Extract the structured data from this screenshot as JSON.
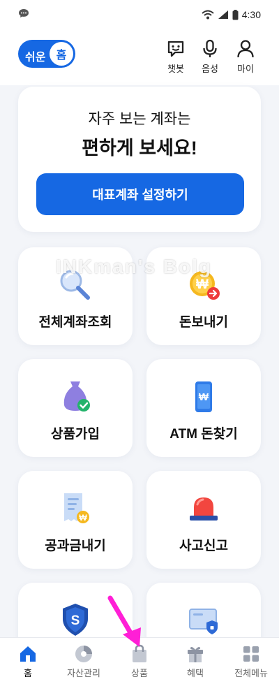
{
  "status_bar": {
    "time": "4:30"
  },
  "header": {
    "easy_mode": {
      "left_label": "쉬운",
      "knob_label": "홈"
    },
    "buttons": [
      {
        "label": "챗봇",
        "icon": "chatbot-icon"
      },
      {
        "label": "음성",
        "icon": "microphone-icon"
      },
      {
        "label": "마이",
        "icon": "person-icon"
      }
    ]
  },
  "hero": {
    "line1": "자주 보는 계좌는",
    "line2": "편하게 보세요!",
    "button_label": "대표계좌 설정하기"
  },
  "tiles": [
    {
      "label": "전체계좌조회",
      "icon": "magnifier-icon"
    },
    {
      "label": "돈보내기",
      "icon": "won-coin-send-icon"
    },
    {
      "label": "상품가입",
      "icon": "money-bag-check-icon"
    },
    {
      "label": "ATM 돈찾기",
      "icon": "atm-phone-icon"
    },
    {
      "label": "공과금내기",
      "icon": "bill-receipt-icon"
    },
    {
      "label": "사고신고",
      "icon": "siren-icon"
    },
    {
      "label": "",
      "icon": "shield-s-icon"
    },
    {
      "label": "",
      "icon": "secure-card-icon"
    }
  ],
  "watermark": "INKman's Bolg",
  "bottom_nav": [
    {
      "label": "홈",
      "icon": "home-icon"
    },
    {
      "label": "자산관리",
      "icon": "pie-chart-icon"
    },
    {
      "label": "상품",
      "icon": "shopping-bag-icon"
    },
    {
      "label": "혜택",
      "icon": "gift-icon"
    },
    {
      "label": "전체메뉴",
      "icon": "grid-icon"
    }
  ],
  "colors": {
    "accent": "#1668e3",
    "annotation_arrow": "#ff1fd6",
    "background": "#f3f5f9"
  }
}
